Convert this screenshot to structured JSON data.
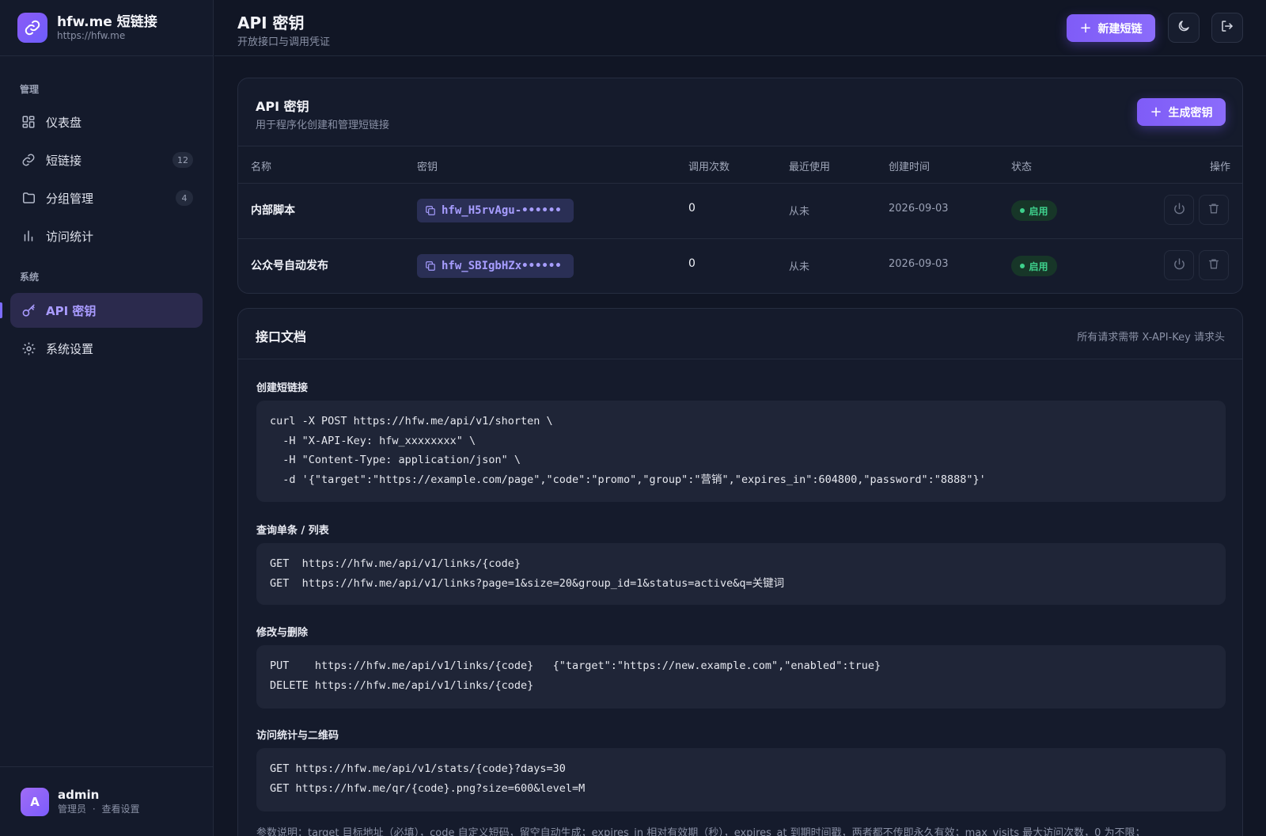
{
  "brand": {
    "name": "hfw.me 短链接",
    "url": "https://hfw.me"
  },
  "sidebar": {
    "section_manage": "管理",
    "section_system": "系统",
    "items": [
      {
        "label": "仪表盘"
      },
      {
        "label": "短链接",
        "badge": "12"
      },
      {
        "label": "分组管理",
        "badge": "4"
      },
      {
        "label": "访问统计"
      },
      {
        "label": "API 密钥"
      },
      {
        "label": "系统设置"
      }
    ],
    "active_item": "API 密钥"
  },
  "user": {
    "avatar_letter": "A",
    "name": "admin",
    "role": "管理员",
    "separator": "·",
    "settings_link": "查看设置"
  },
  "header": {
    "title": "API 密钥",
    "subtitle": "开放接口与调用凭证",
    "new_link_label": "新建短链"
  },
  "icons": {
    "theme": "moon-icon",
    "logout": "logout-icon",
    "copy": "copy-icon",
    "power": "power-icon",
    "delete": "trash-icon"
  },
  "keys_card": {
    "title": "API 密钥",
    "subtitle": "用于程序化创建和管理短链接",
    "generate_label": "生成密钥",
    "columns": [
      "名称",
      "密钥",
      "调用次数",
      "最近使用",
      "创建时间",
      "状态",
      "操作"
    ],
    "rows": [
      {
        "name": "内部脚本",
        "key": "hfw_H5rvAgu-••••••",
        "calls": "0",
        "last_used": "从未",
        "created": "2026-09-03",
        "status": "启用"
      },
      {
        "name": "公众号自动发布",
        "key": "hfw_SBIgbHZx••••••",
        "calls": "0",
        "last_used": "从未",
        "created": "2026-09-03",
        "status": "启用"
      }
    ]
  },
  "docs": {
    "title": "接口文档",
    "header_note": "所有请求需带 X-API-Key 请求头",
    "sections": [
      {
        "heading": "创建短链接",
        "code": "curl -X POST https://hfw.me/api/v1/shorten \\\n  -H \"X-API-Key: hfw_xxxxxxxx\" \\\n  -H \"Content-Type: application/json\" \\\n  -d '{\"target\":\"https://example.com/page\",\"code\":\"promo\",\"group\":\"营销\",\"expires_in\":604800,\"password\":\"8888\"}'"
      },
      {
        "heading": "查询单条 / 列表",
        "code": "GET  https://hfw.me/api/v1/links/{code}\nGET  https://hfw.me/api/v1/links?page=1&size=20&group_id=1&status=active&q=关键词"
      },
      {
        "heading": "修改与删除",
        "code": "PUT    https://hfw.me/api/v1/links/{code}   {\"target\":\"https://new.example.com\",\"enabled\":true}\nDELETE https://hfw.me/api/v1/links/{code}"
      },
      {
        "heading": "访问统计与二维码",
        "code": "GET https://hfw.me/api/v1/stats/{code}?days=30\nGET https://hfw.me/qr/{code}.png?size=600&level=M"
      }
    ],
    "params_note": "参数说明：target 目标地址（必填），code 自定义短码，留空自动生成；expires_in 相对有效期（秒），expires_at 到期时间戳，两者都不传即永久有效；max_visits 最大访问次数，0 为不限；"
  }
}
